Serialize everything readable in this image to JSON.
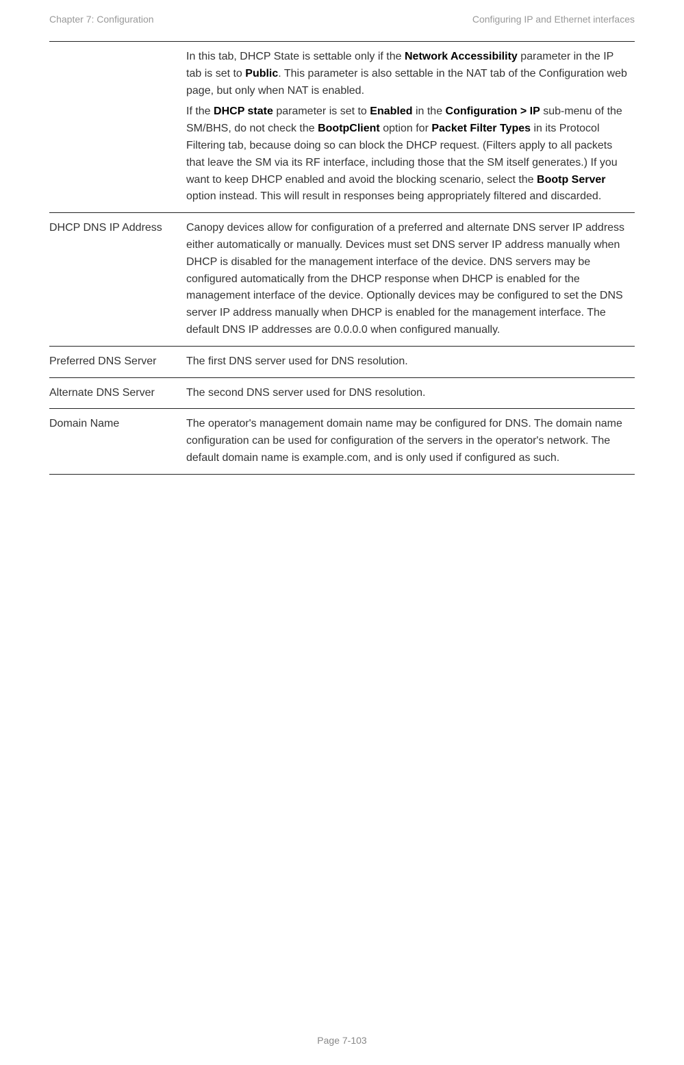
{
  "header": {
    "left": "Chapter 7:  Configuration",
    "right": "Configuring IP and Ethernet interfaces"
  },
  "rows": [
    {
      "label": "",
      "paras": [
        [
          {
            "t": "In this tab, DHCP State is settable only if the "
          },
          {
            "t": "Network Accessibility",
            "b": true
          },
          {
            "t": " parameter in the IP tab is set to "
          },
          {
            "t": "Public",
            "b": true
          },
          {
            "t": ". This parameter is also settable in the NAT tab of the Configuration web page, but only when NAT is enabled."
          }
        ],
        [
          {
            "t": "If the "
          },
          {
            "t": "DHCP state",
            "b": true
          },
          {
            "t": " parameter is set to "
          },
          {
            "t": "Enabled",
            "b": true
          },
          {
            "t": " in the "
          },
          {
            "t": "Configuration > IP",
            "b": true
          },
          {
            "t": " sub-menu of the SM/BHS, do not check the "
          },
          {
            "t": "BootpClient",
            "b": true
          },
          {
            "t": " option for "
          },
          {
            "t": "Packet Filter Types",
            "b": true
          },
          {
            "t": " in its Protocol Filtering tab, because doing so can block the DHCP request. (Filters apply to all packets that leave the SM via its RF interface, including those that the SM itself generates.) If you want to keep DHCP enabled and avoid the blocking scenario, select the "
          },
          {
            "t": "Bootp Server",
            "b": true
          },
          {
            "t": " option instead. This will result in responses being appropriately filtered and discarded."
          }
        ]
      ]
    },
    {
      "label": "DHCP DNS IP Address",
      "paras": [
        [
          {
            "t": "Canopy devices allow for configuration of a preferred and alternate DNS server IP address either automatically or manually. Devices must set DNS server IP address manually when DHCP is disabled for the management interface of the device. DNS servers may be configured automatically from the DHCP response when DHCP is enabled for the management interface of the device. Optionally devices may be configured to set the DNS server IP address manually when DHCP is enabled for the management interface. The default DNS IP addresses are 0.0.0.0 when configured manually."
          }
        ]
      ]
    },
    {
      "label": "Preferred DNS Server",
      "paras": [
        [
          {
            "t": "The first DNS server used for DNS resolution."
          }
        ]
      ]
    },
    {
      "label": "Alternate DNS Server",
      "paras": [
        [
          {
            "t": "The second DNS server used for DNS resolution."
          }
        ]
      ]
    },
    {
      "label": "Domain Name",
      "paras": [
        [
          {
            "t": "The operator's management domain name may be configured for DNS. The domain name configuration can be used for configuration of the servers in the operator's network. The default domain name is example.com, and is only used if configured as such."
          }
        ]
      ]
    }
  ],
  "footer": {
    "page": "Page 7-103"
  }
}
